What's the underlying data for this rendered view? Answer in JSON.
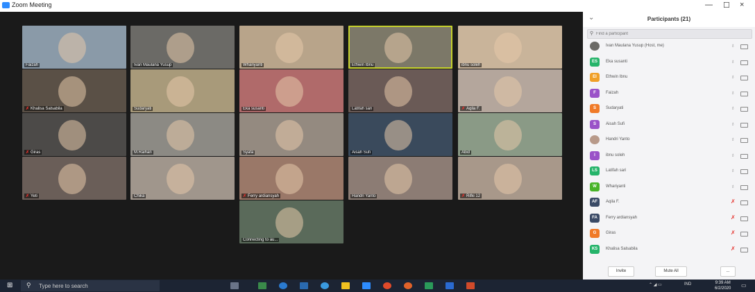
{
  "window": {
    "title": "Zoom Meeting",
    "controls": [
      "—",
      "☐",
      "×"
    ]
  },
  "gallery": {
    "tiles": [
      {
        "name": "Faizah",
        "muted": false,
        "active": false,
        "bg": "#8a9aa8"
      },
      {
        "name": "Ivan Maulana Yusup",
        "muted": false,
        "active": false,
        "bg": "#6b6a66"
      },
      {
        "name": "Whariyanti",
        "muted": false,
        "active": false,
        "bg": "#b8a48a"
      },
      {
        "name": "Ethwin Ibnu",
        "muted": false,
        "active": true,
        "bg": "#7c7868"
      },
      {
        "name": "ibnu soleh",
        "muted": false,
        "active": false,
        "bg": "#c9b49a"
      },
      {
        "name": "Khalisa Salsabila",
        "muted": true,
        "active": false,
        "bg": "#5a5046"
      },
      {
        "name": "Sudaryati",
        "muted": false,
        "active": false,
        "bg": "#a89a7a"
      },
      {
        "name": "Eka susanti",
        "muted": false,
        "active": false,
        "bg": "#b06a6a"
      },
      {
        "name": "Latifah sari",
        "muted": false,
        "active": false,
        "bg": "#6a5a56"
      },
      {
        "name": "Aqila F.",
        "muted": true,
        "active": false,
        "bg": "#b4a69c"
      },
      {
        "name": "Giras",
        "muted": true,
        "active": false,
        "bg": "#4c4a48"
      },
      {
        "name": "M.Raihan",
        "muted": false,
        "active": false,
        "bg": "#8c8a84"
      },
      {
        "name": "Syafa",
        "muted": false,
        "active": false,
        "bg": "#948a80"
      },
      {
        "name": "Aisah Sufi",
        "muted": false,
        "active": false,
        "bg": "#3a4a5c"
      },
      {
        "name": "Abid",
        "muted": false,
        "active": false,
        "bg": "#8a9a86"
      },
      {
        "name": "Yeti",
        "muted": true,
        "active": false,
        "bg": "#6a5e58"
      },
      {
        "name": "Chika",
        "muted": false,
        "active": false,
        "bg": "#a0968c"
      },
      {
        "name": "Ferry ardiansyah",
        "muted": true,
        "active": false,
        "bg": "#9a7868"
      },
      {
        "name": "Handri Yanto",
        "muted": false,
        "active": false,
        "bg": "#8c7c74"
      },
      {
        "name": "Rifki 12",
        "muted": true,
        "active": false,
        "bg": "#a8988a"
      },
      {
        "name": "Connecting to au...",
        "muted": false,
        "active": false,
        "bg": "#5a6a5a"
      }
    ]
  },
  "participants_panel": {
    "title": "Participants (21)",
    "search_placeholder": "Find a participant",
    "rows": [
      {
        "initials": "",
        "name": "Ivan Maulana Yusup (Host, me)",
        "color": "#6b6a66",
        "photo": true,
        "mic_muted": false
      },
      {
        "initials": "ES",
        "name": "Eka susanti",
        "color": "#25b46a",
        "mic_muted": false
      },
      {
        "initials": "EI",
        "name": "Ethwin Ibnu",
        "color": "#f0a028",
        "mic_muted": false
      },
      {
        "initials": "F",
        "name": "Faizah",
        "color": "#9a52c8",
        "mic_muted": false
      },
      {
        "initials": "S",
        "name": "Sudaryati",
        "color": "#f07a28",
        "mic_muted": false
      },
      {
        "initials": "S",
        "name": "Aisah Sufi",
        "color": "#9a52c8",
        "mic_muted": false
      },
      {
        "initials": "",
        "name": "Handri Yanto",
        "color": "#b89a8a",
        "photo": true,
        "mic_muted": false
      },
      {
        "initials": "I",
        "name": "ibnu soleh",
        "color": "#9a52c8",
        "mic_muted": false
      },
      {
        "initials": "LS",
        "name": "Latifah sari",
        "color": "#25b46a",
        "mic_muted": false
      },
      {
        "initials": "W",
        "name": "Whariyanti",
        "color": "#48b428",
        "mic_muted": false
      },
      {
        "initials": "AF",
        "name": "Aqila F.",
        "color": "#3a4a66",
        "mic_muted": true
      },
      {
        "initials": "FA",
        "name": "Ferry ardiansyah",
        "color": "#3a4a66",
        "mic_muted": true
      },
      {
        "initials": "G",
        "name": "Giras",
        "color": "#f07a28",
        "mic_muted": true
      },
      {
        "initials": "KS",
        "name": "Khalisa Salsabila",
        "color": "#25b46a",
        "mic_muted": true
      }
    ],
    "footer": {
      "invite": "Invite",
      "mute_all": "Mute All",
      "more": "..."
    }
  },
  "taskbar": {
    "search_placeholder": "Type here to search",
    "tray": {
      "lang": "IND",
      "time": "9:39 AM",
      "date": "6/2/2020"
    }
  },
  "colors": {
    "active_speaker": "#c6d22b",
    "muted_red": "#e5322d",
    "zoom_blue": "#2d8cff"
  }
}
